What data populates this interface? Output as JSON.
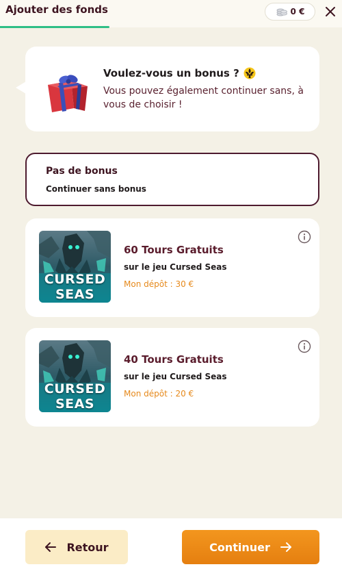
{
  "header": {
    "title": "Ajouter des fonds",
    "balance": "0 €",
    "close_icon": "close-icon",
    "coins_icon": "coins-icon"
  },
  "info": {
    "title": "Voulez-vous un bonus ?",
    "subtitle": "Vous pouvez également continuer sans, à vous de choisir !",
    "gift_icon": "gift-icon",
    "emblem_icon": "fleur-de-lis-icon"
  },
  "no_bonus": {
    "title": "Pas de bonus",
    "subtitle": "Continuer sans bonus"
  },
  "offers": [
    {
      "title": "60 Tours Gratuits",
      "game": "sur le jeu Cursed Seas",
      "deposit": "Mon dépôt : 30 €",
      "image_text_line1": "CURSED",
      "image_text_line2": "SEAS"
    },
    {
      "title": "40 Tours Gratuits",
      "game": "sur le jeu Cursed Seas",
      "deposit": "Mon dépôt : 20 €",
      "image_text_line1": "CURSED",
      "image_text_line2": "SEAS"
    }
  ],
  "footer": {
    "back_label": "Retour",
    "continue_label": "Continuer"
  },
  "colors": {
    "accent_orange": "#ed8716",
    "progress_green": "#2fbf86",
    "dark_burgundy": "#3d1420",
    "background": "#f4f1e6",
    "deposit_orange": "#e6891b"
  }
}
